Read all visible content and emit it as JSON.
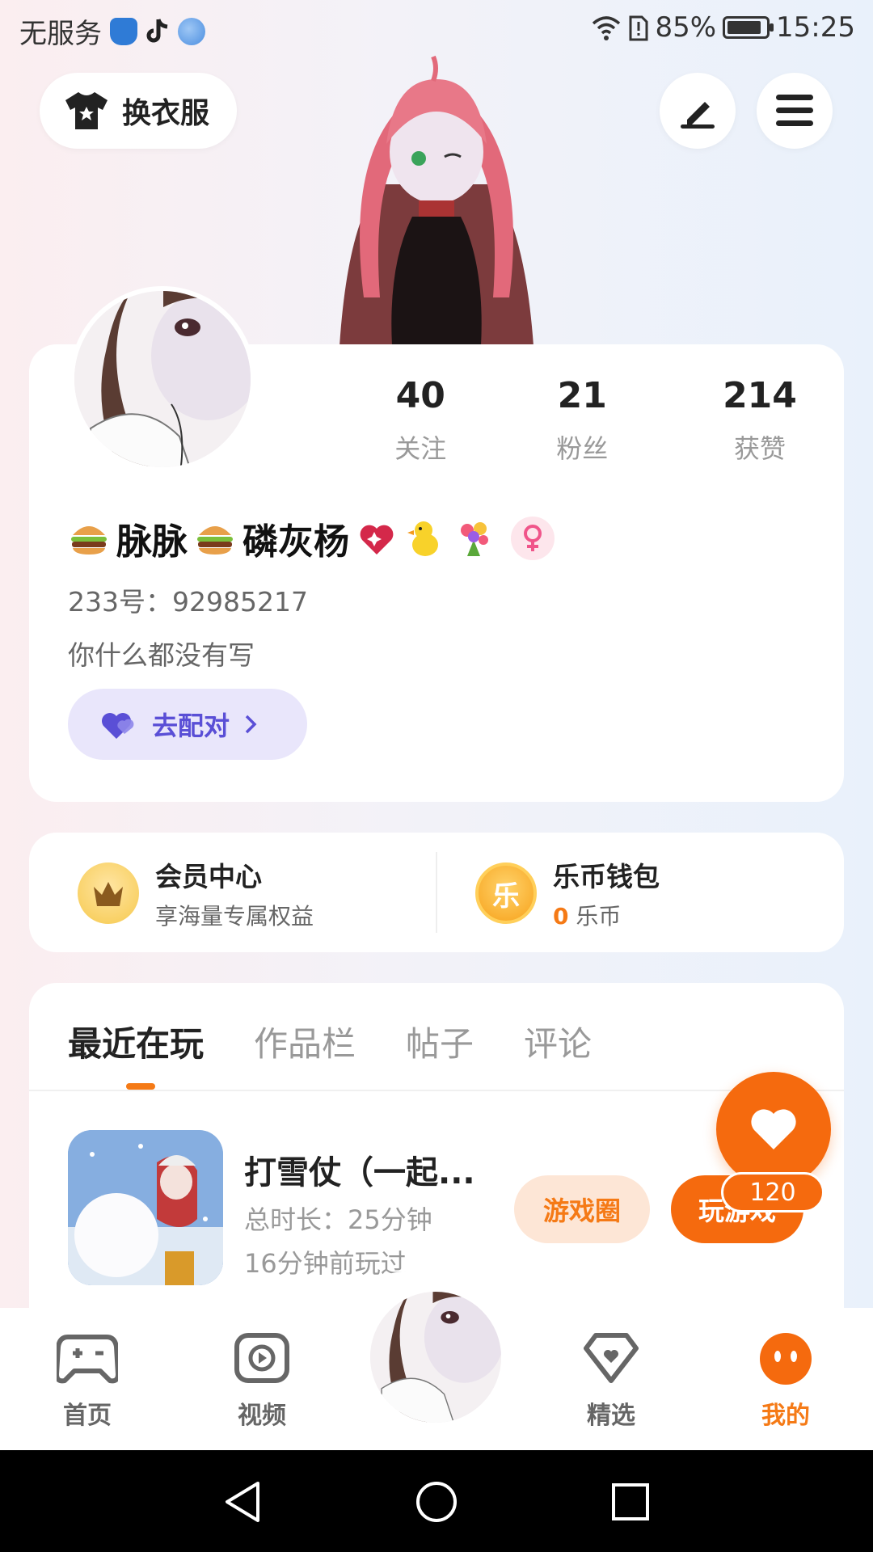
{
  "status_bar": {
    "carrier": "无服务",
    "battery": "85%",
    "time": "15:25"
  },
  "top_actions": {
    "outfit_label": "换衣服"
  },
  "profile": {
    "stats": [
      {
        "value": "40",
        "label": "关注"
      },
      {
        "value": "21",
        "label": "粉丝"
      },
      {
        "value": "214",
        "label": "获赞"
      }
    ],
    "username_parts": [
      "脉脉",
      "磷灰杨"
    ],
    "uid": "233号：92985217",
    "bio": "你什么都没有写",
    "match_label": "去配对"
  },
  "member": {
    "center_title": "会员中心",
    "center_sub": "享海量专属权益",
    "wallet_title": "乐币钱包",
    "wallet_amount": "0",
    "wallet_unit": "乐币",
    "coin_glyph": "乐"
  },
  "tabs": [
    {
      "label": "最近在玩",
      "active": true
    },
    {
      "label": "作品栏",
      "active": false
    },
    {
      "label": "帖子",
      "active": false
    },
    {
      "label": "评论",
      "active": false
    }
  ],
  "recent_game": {
    "title": "打雪仗（一起...",
    "total_time": "总时长：25分钟",
    "last_played": "16分钟前玩过",
    "circle_label": "游戏圈",
    "play_label": "玩游戏"
  },
  "like": {
    "count": "120"
  },
  "bottom_nav": [
    {
      "label": "首页",
      "icon": "gamepad-icon"
    },
    {
      "label": "视频",
      "icon": "video-icon"
    },
    {
      "label": "精选",
      "icon": "heart-gem-icon"
    },
    {
      "label": "我的",
      "icon": "face-icon",
      "active": true
    }
  ],
  "colors": {
    "accent": "#f56a0e",
    "match_text": "#5a4fd6",
    "match_bg": "#e9e6fb"
  }
}
